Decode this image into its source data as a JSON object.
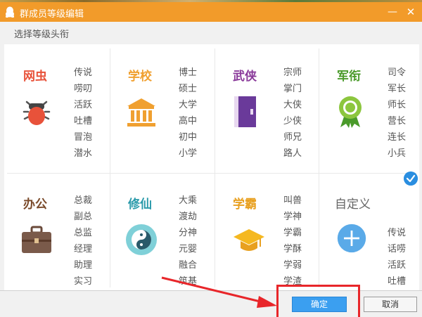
{
  "window": {
    "title": "群成员等级编辑",
    "minimize_symbol": "—",
    "close_symbol": "✕"
  },
  "subtitle": "选择等级头衔",
  "categories": [
    {
      "name": "网虫",
      "color": "#e8523a",
      "icon": "bug-icon",
      "items": [
        "传说",
        "唠叨",
        "活跃",
        "吐槽",
        "冒泡",
        "潜水"
      ]
    },
    {
      "name": "学校",
      "color": "#f0a030",
      "icon": "school-icon",
      "items": [
        "博士",
        "硕士",
        "大学",
        "高中",
        "初中",
        "小学"
      ]
    },
    {
      "name": "武侠",
      "color": "#8a3a9a",
      "icon": "book-icon",
      "items": [
        "宗师",
        "掌门",
        "大侠",
        "少侠",
        "师兄",
        "路人"
      ]
    },
    {
      "name": "军衔",
      "color": "#4a9a2a",
      "icon": "medal-icon",
      "items": [
        "司令",
        "军长",
        "师长",
        "营长",
        "连长",
        "小兵"
      ]
    },
    {
      "name": "办公",
      "color": "#7a4a2a",
      "icon": "briefcase-icon",
      "items": [
        "总裁",
        "副总",
        "总监",
        "经理",
        "助理",
        "实习"
      ]
    },
    {
      "name": "修仙",
      "color": "#2a9aaa",
      "icon": "yin-yang-icon",
      "items": [
        "大乘",
        "渡劫",
        "分神",
        "元婴",
        "融合",
        "筑基"
      ]
    },
    {
      "name": "学霸",
      "color": "#e8a020",
      "icon": "graduation-cap-icon",
      "items": [
        "叫兽",
        "学神",
        "学霸",
        "学酥",
        "学弱",
        "学渣"
      ]
    },
    {
      "name": "自定义",
      "color": "#666666",
      "icon": "plus-icon",
      "items": [
        "传说",
        "话唠",
        "活跃",
        "吐槽"
      ]
    }
  ],
  "selected_category": "自定义",
  "buttons": {
    "ok": "确定",
    "cancel": "取消"
  },
  "colors": {
    "title_bar": "#f29b2a",
    "selection_check": "#2a8ee0",
    "ok_button": "#3b9ff0",
    "annotation": "#e8262a"
  }
}
